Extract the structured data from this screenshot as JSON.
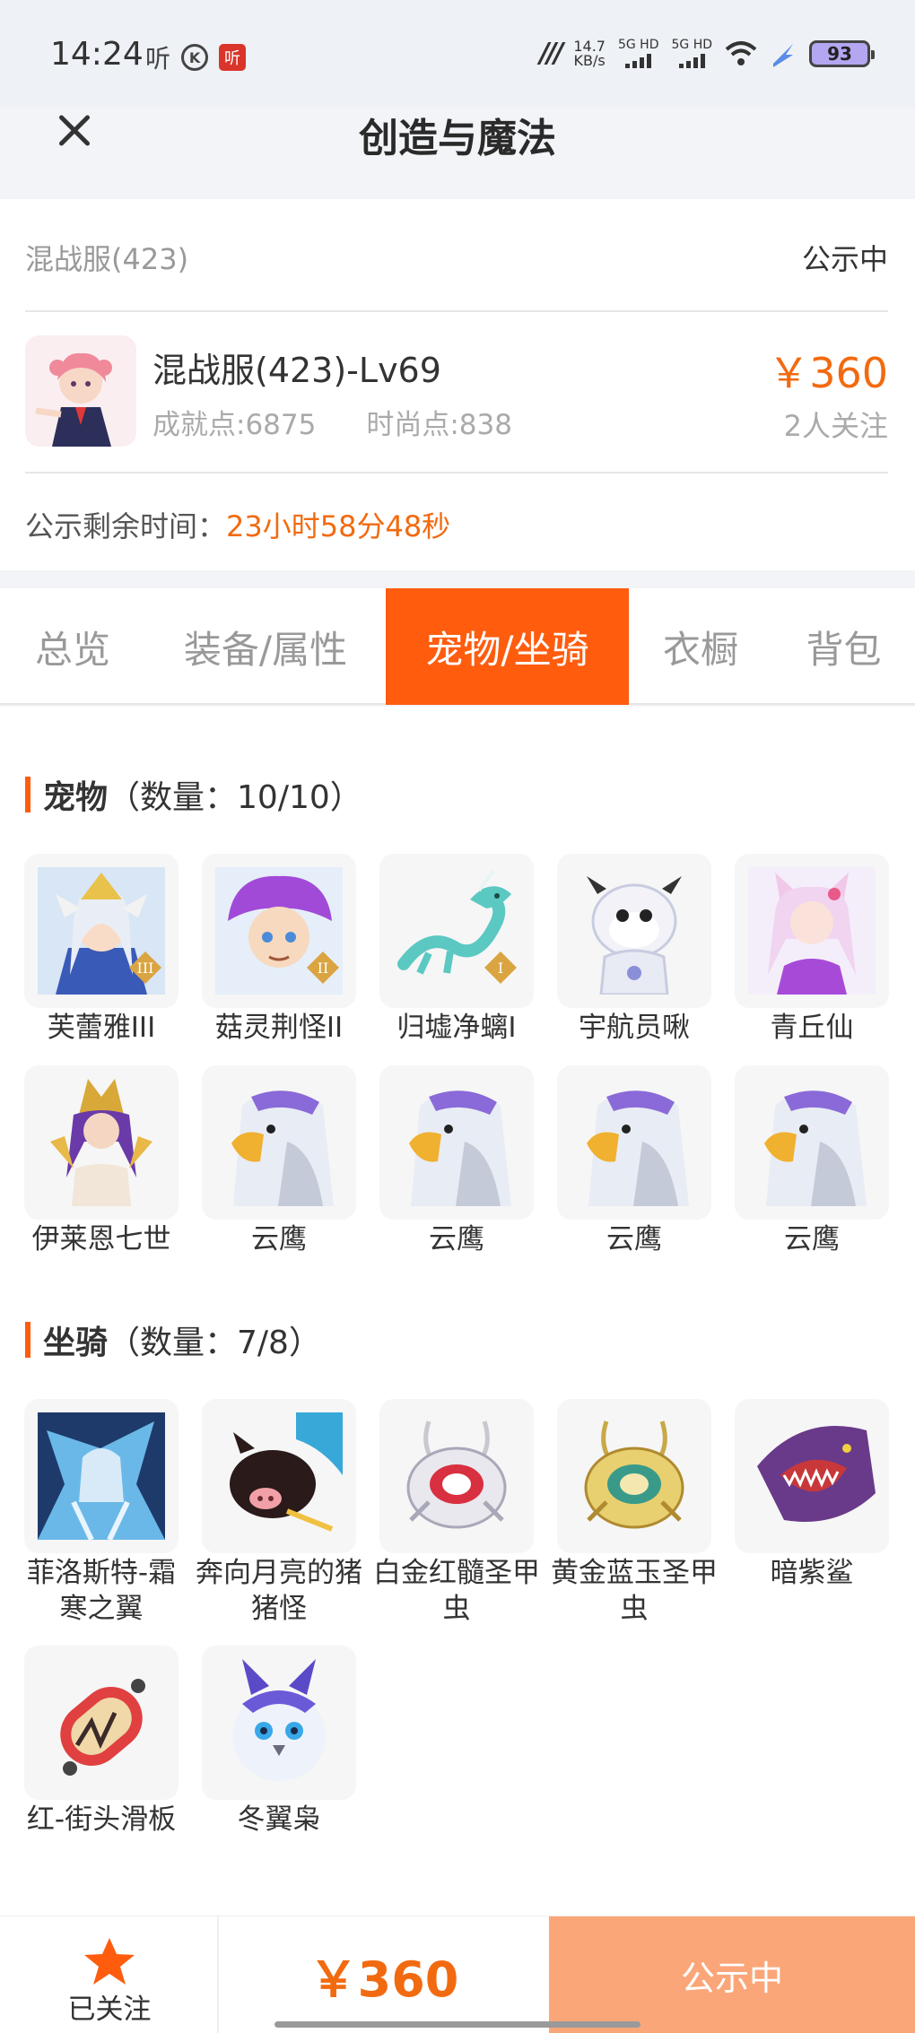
{
  "status_bar": {
    "time": "14:24",
    "icon_listen": "听",
    "icon_k": "K",
    "icon_red": "听",
    "speed_value": "14.7",
    "speed_unit": "KB/s",
    "signal1": "5G HD",
    "signal2": "5G HD",
    "battery": "93"
  },
  "header": {
    "title": "创造与魔法"
  },
  "account": {
    "server": "混战服(423)",
    "status": "公示中",
    "role_title": "混战服(423)-Lv69",
    "achievement": "成就点:6875",
    "fashion": "时尚点:838",
    "price": "￥360",
    "followers": "2人关注",
    "countdown_label": "公示剩余时间：",
    "countdown_value": "23小时58分48秒"
  },
  "tabs": [
    {
      "label": "总览",
      "active": false
    },
    {
      "label": "装备/属性",
      "active": false
    },
    {
      "label": "宠物/坐骑",
      "active": true
    },
    {
      "label": "衣橱",
      "active": false
    },
    {
      "label": "背包",
      "active": false
    }
  ],
  "pets": {
    "title": "宠物",
    "count": "（数量：10/10）",
    "items": [
      {
        "name": "芙蕾雅III",
        "icon": "angel-warrior-icon"
      },
      {
        "name": "菇灵荆怪II",
        "icon": "mushroom-sprite-icon"
      },
      {
        "name": "归墟净螭I",
        "icon": "jade-dragon-icon"
      },
      {
        "name": "宇航员啾",
        "icon": "astronaut-cow-icon"
      },
      {
        "name": "青丘仙",
        "icon": "fox-fairy-icon"
      },
      {
        "name": "伊莱恩七世",
        "icon": "pharaoh-queen-icon"
      },
      {
        "name": "云鹰",
        "icon": "eagle-icon"
      },
      {
        "name": "云鹰",
        "icon": "eagle-icon"
      },
      {
        "name": "云鹰",
        "icon": "eagle-icon"
      },
      {
        "name": "云鹰",
        "icon": "eagle-icon"
      }
    ]
  },
  "mounts": {
    "title": "坐骑",
    "count": "（数量：7/8）",
    "items": [
      {
        "name": "菲洛斯特-霜寒之翼",
        "icon": "frost-dragon-icon"
      },
      {
        "name": "奔向月亮的猪猪怪",
        "icon": "pig-icon"
      },
      {
        "name": "白金红髓圣甲虫",
        "icon": "white-beetle-icon"
      },
      {
        "name": "黄金蓝玉圣甲虫",
        "icon": "gold-beetle-icon"
      },
      {
        "name": "暗紫鲨",
        "icon": "purple-shark-icon"
      },
      {
        "name": "红-街头滑板",
        "icon": "skateboard-icon"
      },
      {
        "name": "冬翼枭",
        "icon": "snow-owl-icon"
      }
    ]
  },
  "bottom": {
    "follow_label": "已关注",
    "price": "￥360",
    "action_label": "公示中"
  },
  "colors": {
    "accent": "#ff5c0e",
    "price": "#f26a10",
    "action_bg": "#fba678"
  }
}
